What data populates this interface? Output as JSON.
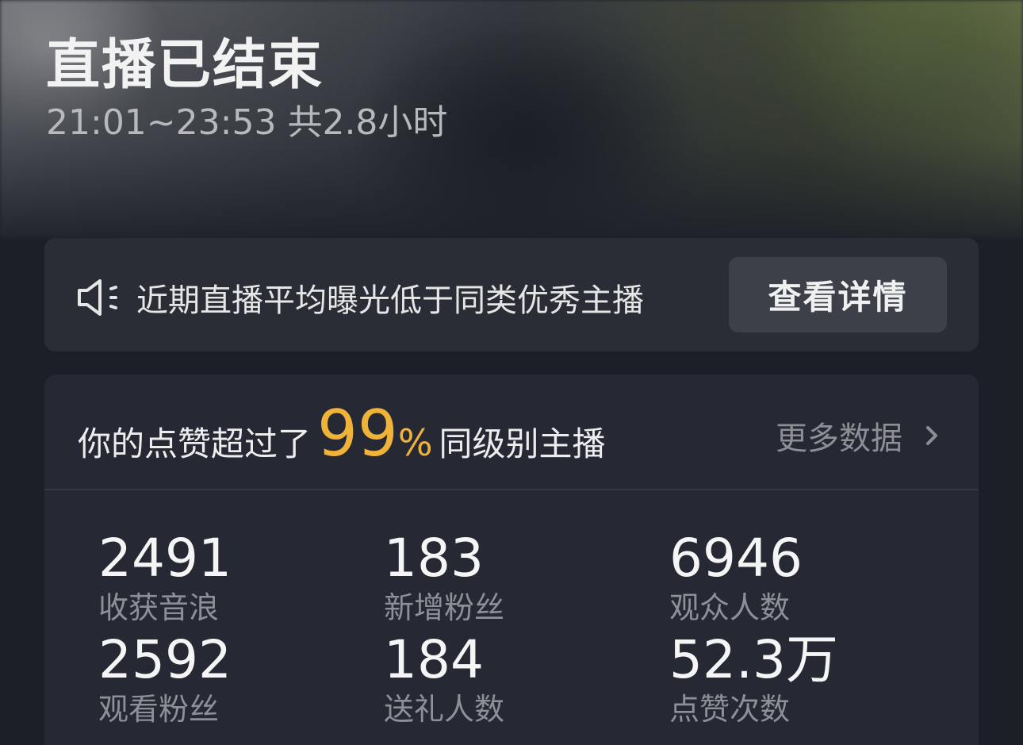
{
  "header": {
    "title": "直播已结束",
    "time_range": "21:01~23:53 共2.8小时"
  },
  "notice": {
    "text": "近期直播平均曝光低于同类优秀主播",
    "button_label": "查看详情",
    "icon": "speaker-icon"
  },
  "rank": {
    "prefix": "你的点赞超过了",
    "percent": "99",
    "percent_sign": "%",
    "suffix": "同级别主播",
    "more_label": "更多数据",
    "accent_color": "#f0b33a"
  },
  "metrics": [
    {
      "value": "2491",
      "label": "收获音浪"
    },
    {
      "value": "183",
      "label": "新增粉丝"
    },
    {
      "value": "6946",
      "label": "观众人数"
    },
    {
      "value": "2592",
      "label": "观看粉丝"
    },
    {
      "value": "184",
      "label": "送礼人数"
    },
    {
      "value": "52.3万",
      "label": "点赞次数"
    }
  ]
}
